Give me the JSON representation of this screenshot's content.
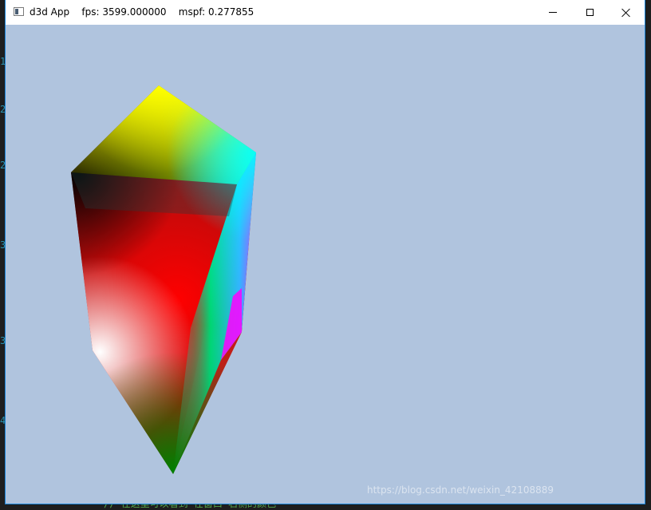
{
  "window": {
    "title_app": "d3d App",
    "title_fps": "fps: 3599.000000",
    "title_mspf": "mspf: 0.277855",
    "background_color": "#b0c4de"
  },
  "icons": {
    "app": "window-icon",
    "minimize": "minimize-icon",
    "maximize": "maximize-icon",
    "close": "close-icon"
  },
  "mesh_vertex_colors": {
    "top": "#ffff00",
    "upper_right": "#00ffff",
    "upper_left": "#000000",
    "center": "#ff0000",
    "lower_left": "#ffffff",
    "right": "#ff00ff",
    "bottom": "#008000"
  },
  "watermark": "https://blog.csdn.net/weixin_42108889",
  "background_editor": {
    "footer_text": "// 在这里可以看到 在窗口 右侧的颜色"
  }
}
